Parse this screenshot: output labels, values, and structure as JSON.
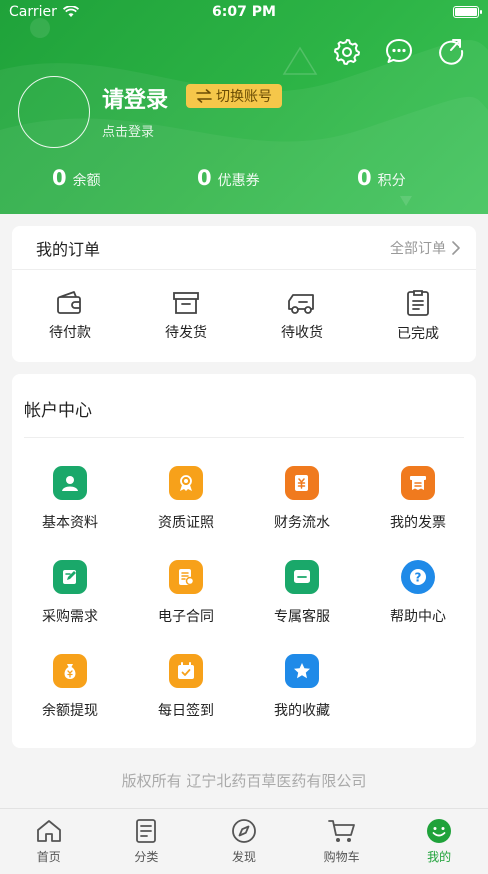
{
  "status_bar": {
    "carrier": "Carrier",
    "time": "6:07 PM"
  },
  "profile": {
    "title": "请登录",
    "switch_label": "切换账号",
    "subtitle": "点击登录"
  },
  "stats": [
    {
      "value": "0",
      "label": "余额"
    },
    {
      "value": "0",
      "label": "优惠券"
    },
    {
      "value": "0",
      "label": "积分"
    }
  ],
  "orders": {
    "title": "我的订单",
    "all_label": "全部订单",
    "items": [
      {
        "label": "待付款",
        "icon": "wallet-icon"
      },
      {
        "label": "待发货",
        "icon": "box-icon"
      },
      {
        "label": "待收货",
        "icon": "truck-icon"
      },
      {
        "label": "已完成",
        "icon": "checklist-icon"
      }
    ]
  },
  "account": {
    "title": "帐户中心",
    "items": [
      {
        "label": "基本资料",
        "icon": "user-icon",
        "color": "#1aa86a"
      },
      {
        "label": "资质证照",
        "icon": "certificate-icon",
        "color": "#f7a11a"
      },
      {
        "label": "财务流水",
        "icon": "finance-icon",
        "color": "#f07a1e"
      },
      {
        "label": "我的发票",
        "icon": "invoice-icon",
        "color": "#f07a1e"
      },
      {
        "label": "采购需求",
        "icon": "edit-icon",
        "color": "#1aa86a"
      },
      {
        "label": "电子合同",
        "icon": "contract-icon",
        "color": "#f7a11a"
      },
      {
        "label": "专属客服",
        "icon": "chat-icon",
        "color": "#1aa86a"
      },
      {
        "label": "帮助中心",
        "icon": "help-icon",
        "color": "#1f8ae8"
      },
      {
        "label": "余额提现",
        "icon": "moneybag-icon",
        "color": "#f7a11a"
      },
      {
        "label": "每日签到",
        "icon": "calendar-icon",
        "color": "#f7a11a"
      },
      {
        "label": "我的收藏",
        "icon": "star-icon",
        "color": "#1f8ae8"
      }
    ]
  },
  "copyright": "版权所有 辽宁北药百草医药有限公司",
  "tabs": [
    {
      "label": "首页",
      "icon": "home-icon"
    },
    {
      "label": "分类",
      "icon": "category-icon"
    },
    {
      "label": "发现",
      "icon": "compass-icon"
    },
    {
      "label": "购物车",
      "icon": "cart-icon"
    },
    {
      "label": "我的",
      "icon": "smile-icon",
      "active": true
    }
  ],
  "colors": {
    "brand": "#1fa23a",
    "switch_bg": "#f5c74a"
  }
}
